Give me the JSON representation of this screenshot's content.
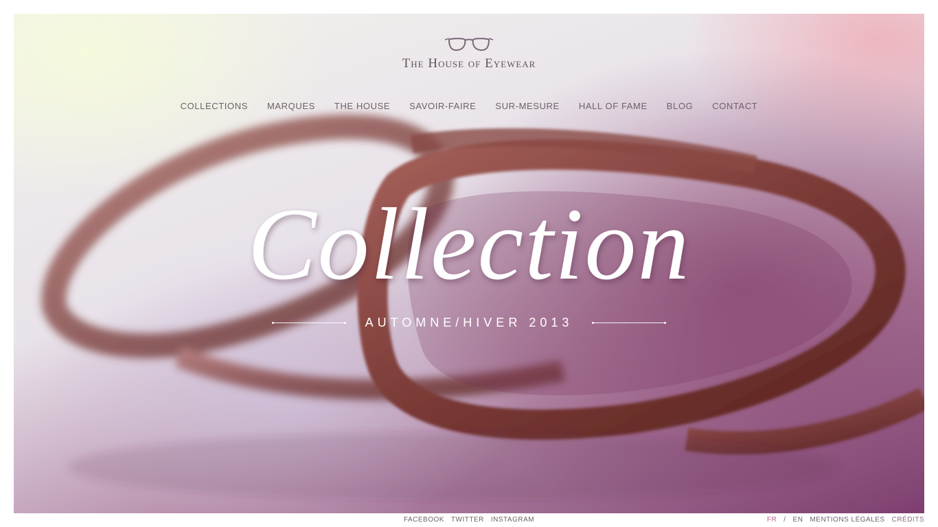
{
  "brand": {
    "name": "The House of Eyewear",
    "logo_icon": "glasses-icon"
  },
  "nav": {
    "items": [
      {
        "label": "COLLECTIONS"
      },
      {
        "label": "MARQUES"
      },
      {
        "label": "THE HOUSE"
      },
      {
        "label": "SAVOIR-FAIRE"
      },
      {
        "label": "SUR-MESURE"
      },
      {
        "label": "HALL OF FAME"
      },
      {
        "label": "BLOG"
      },
      {
        "label": "CONTACT"
      }
    ]
  },
  "hero": {
    "headline": "Collection",
    "subtitle": "AUTOMNE/HIVER 2013"
  },
  "footer": {
    "social": [
      {
        "label": "FACEBOOK"
      },
      {
        "label": "TWITTER"
      },
      {
        "label": "INSTAGRAM"
      }
    ],
    "lang_fr": "FR",
    "lang_separator": "/",
    "lang_en": "EN",
    "legal": "MENTIONS LÉGALES",
    "credits": "CRÉDITS"
  },
  "colors": {
    "accent": "#c06090",
    "text": "#6d6168",
    "frame": "#6b2e2a"
  }
}
